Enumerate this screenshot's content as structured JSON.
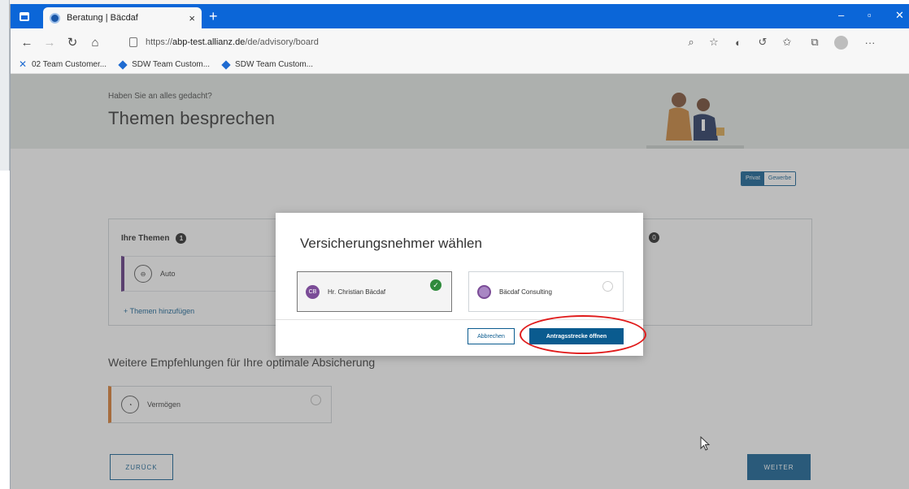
{
  "browser": {
    "tab_title": "Beratung | Bäcdaf",
    "tab_close": "×",
    "new_tab": "+",
    "window_controls": {
      "minimize": "–",
      "maximize": "▫",
      "close": "✕"
    },
    "url_prefix": "https://",
    "url_host": "abp-test.allianz.de",
    "url_path": "/de/advisory/board",
    "favorites": [
      {
        "label": "02 Team Customer...",
        "icon": "tool-icon"
      },
      {
        "label": "SDW Team Custom...",
        "icon": "diamond-icon"
      },
      {
        "label": "SDW Team Custom...",
        "icon": "diamond-icon"
      }
    ],
    "toolbar_icons": [
      "zoom-icon",
      "favorite-add-icon",
      "extension-icon",
      "refresh-profile-icon",
      "favorites-icon",
      "collections-icon",
      "profile-icon",
      "more-icon"
    ],
    "accent_color": "#0b66d8"
  },
  "page": {
    "hero_subtitle": "Haben Sie an alles gedacht?",
    "hero_title": "Themen besprechen",
    "toggle_private": "Privat",
    "toggle_business": "Gewerbe",
    "topics_heading": "Ihre Themen",
    "topics_count": "1",
    "topics_count_right": "0",
    "topic_auto": "Auto",
    "add_topic": "+  Themen hinzufügen",
    "reco_heading": "Weitere Empfehlungen für Ihre optimale Absicherung",
    "reco_item": "Vermögen",
    "back_button": "ZURÜCK",
    "next_button": "WEITER",
    "primary_color": "#0a5b8f"
  },
  "modal": {
    "title": "Versicherungsnehmer wählen",
    "option_1": {
      "initials": "CB",
      "label": "Hr. Christian Bäcdaf",
      "selected": true
    },
    "option_2": {
      "initials": "",
      "label": "Bäcdaf Consulting",
      "selected": false
    },
    "cancel_button": "Abbrechen",
    "open_button": "Antragsstrecke öffnen",
    "annotation_color": "#e01b1b"
  }
}
